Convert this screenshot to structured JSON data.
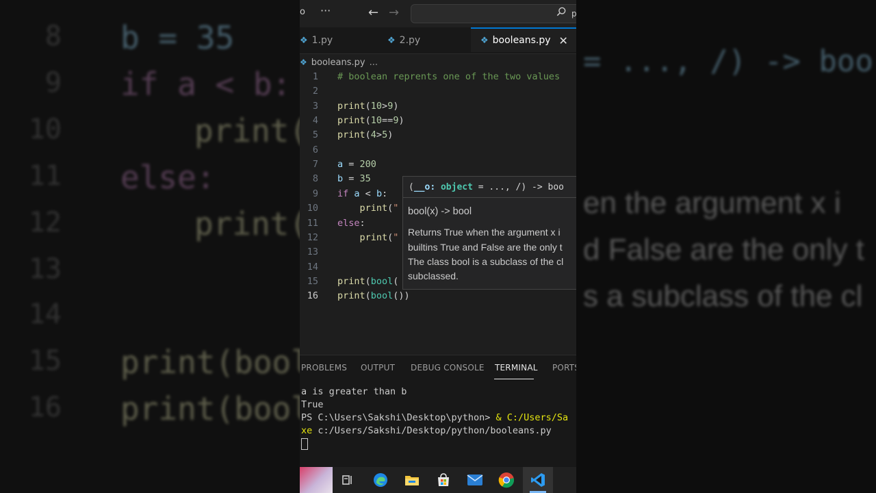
{
  "background_left": {
    "line_numbers": [
      "8",
      "9",
      "10",
      "11",
      "12",
      "13",
      "14",
      "15",
      "16"
    ],
    "lines": [
      "b = 35",
      "if a < b:",
      "print(",
      "else:",
      "print(",
      "print(bool",
      "print(bool"
    ]
  },
  "background_right": {
    "lines": [
      "= ..., /) -> boo",
      "en the argument x i",
      "d False are the only t",
      "s a subclass of the cl"
    ]
  },
  "titlebar": {
    "left_text": "o",
    "menu_label": "···",
    "back_label": "←",
    "forward_label": "→",
    "search_text": "p"
  },
  "tabs": [
    {
      "label": "1.py",
      "icon": "python-file-icon",
      "active": false
    },
    {
      "label": "2.py",
      "icon": "python-file-icon",
      "active": false
    },
    {
      "label": "booleans.py",
      "icon": "python-file-icon",
      "active": true,
      "close_label": "✕"
    }
  ],
  "breadcrumb": {
    "file": "booleans.py",
    "rest": "..."
  },
  "editor": {
    "current_line": 16,
    "lines": [
      {
        "n": "1",
        "t": "# boolean reprents one of the two values"
      },
      {
        "n": "2",
        "t": ""
      },
      {
        "n": "3",
        "t": "print(10>9)"
      },
      {
        "n": "4",
        "t": "print(10==9)"
      },
      {
        "n": "5",
        "t": "print(4>5)"
      },
      {
        "n": "6",
        "t": ""
      },
      {
        "n": "7",
        "t": "a = 200"
      },
      {
        "n": "8",
        "t": "b = 35"
      },
      {
        "n": "9",
        "t": "if a < b:"
      },
      {
        "n": "10",
        "t": "    print(\""
      },
      {
        "n": "11",
        "t": "else:"
      },
      {
        "n": "12",
        "t": "    print(\""
      },
      {
        "n": "13",
        "t": ""
      },
      {
        "n": "14",
        "t": ""
      },
      {
        "n": "15",
        "t": "print(bool("
      },
      {
        "n": "16",
        "t": "print(bool())"
      }
    ]
  },
  "hover": {
    "signature_open": "(",
    "signature_param": "__o",
    "signature_mid": ": ",
    "signature_type": "object",
    "signature_rest": " = ..., /) -> boo",
    "title": "bool(x) -> bool",
    "doc_lines": [
      "Returns True when the argument x i",
      "builtins True and False are the only t",
      "The class bool is a subclass of the cl",
      "subclassed."
    ]
  },
  "panel": {
    "tabs": [
      "PROBLEMS",
      "OUTPUT",
      "DEBUG CONSOLE",
      "TERMINAL",
      "PORTS"
    ],
    "active_tab": "TERMINAL",
    "terminal": {
      "line1": "a is greater than b",
      "line2": "True",
      "prompt": "PS C:\\Users\\Sakshi\\Desktop\\python> ",
      "command_start": "& C:/Users/Sa",
      "command_cont_a": "xe",
      "command_cont_b": " c:/Users/Sakshi/Desktop/python/booleans.py"
    }
  },
  "taskbar": {
    "items": [
      "wallpaper-thumbnail",
      "task-view-icon",
      "edge-icon",
      "file-explorer-icon",
      "store-icon",
      "mail-icon",
      "chrome-icon",
      "vscode-icon"
    ]
  },
  "colors": {
    "editor_bg": "#1e1e1e",
    "accent": "#0078d4",
    "comment": "#6a9955",
    "function": "#dcdcaa",
    "number": "#b5cea8",
    "keyword": "#c586c0",
    "variable": "#9cdcfe"
  }
}
